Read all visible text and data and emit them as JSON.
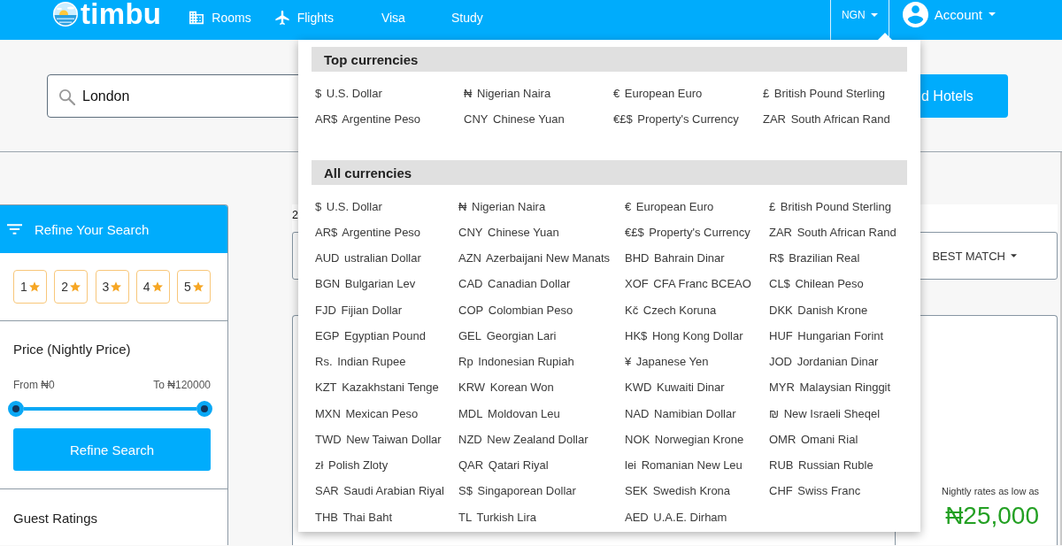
{
  "nav": {
    "logo": "timbu",
    "links": [
      {
        "label": "Rooms"
      },
      {
        "label": "Flights"
      },
      {
        "label": "Visa"
      },
      {
        "label": "Study"
      }
    ],
    "currency": "NGN",
    "account": "Account"
  },
  "search": {
    "value": "London",
    "button": "d Hotels"
  },
  "sidebar": {
    "title": "Refine Your Search",
    "star_filters": [
      "1",
      "2",
      "3",
      "4",
      "5"
    ],
    "price": {
      "title": "Price (Nightly Price)",
      "from": "From ₦0",
      "to": "To ₦120000",
      "thumbs": [
        {
          "level": 0
        },
        {
          "level": 1
        }
      ],
      "button": "Refine Search"
    },
    "guest_ratings": "Guest Ratings"
  },
  "results": {
    "heading": "2",
    "sort": "BEST MATCH",
    "card": {
      "rate_label": "Nightly rates as low as",
      "rate": "₦25,000"
    }
  },
  "currency_menu": {
    "expanded": true,
    "sections": [
      {
        "title": "Top currencies",
        "items": [
          {
            "symbol": "$",
            "name": "U.S. Dollar"
          },
          {
            "symbol": "₦",
            "name": "Nigerian Naira"
          },
          {
            "symbol": "€",
            "name": "European Euro"
          },
          {
            "symbol": "£",
            "name": "British Pound Sterling"
          },
          {
            "symbol": "AR$",
            "name": "Argentine Peso"
          },
          {
            "symbol": "CNY",
            "name": "Chinese Yuan"
          },
          {
            "symbol": "€£$",
            "name": "Property's Currency"
          },
          {
            "symbol": "ZAR",
            "name": "South African Rand"
          }
        ]
      },
      {
        "title": "All currencies",
        "items": [
          {
            "symbol": "$",
            "name": "U.S. Dollar"
          },
          {
            "symbol": "₦",
            "name": "Nigerian Naira"
          },
          {
            "symbol": "€",
            "name": "European Euro"
          },
          {
            "symbol": "£",
            "name": "British Pound Sterling"
          },
          {
            "symbol": "AR$",
            "name": "Argentine Peso"
          },
          {
            "symbol": "CNY",
            "name": "Chinese Yuan"
          },
          {
            "symbol": "€£$",
            "name": "Property's Currency"
          },
          {
            "symbol": "ZAR",
            "name": "South African Rand"
          },
          {
            "symbol": "AUD",
            "name": "ustralian Dollar"
          },
          {
            "symbol": "AZN",
            "name": "Azerbaijani New Manats"
          },
          {
            "symbol": "BHD",
            "name": "Bahrain Dinar"
          },
          {
            "symbol": "R$",
            "name": "Brazilian Real"
          },
          {
            "symbol": "BGN",
            "name": "Bulgarian Lev"
          },
          {
            "symbol": "CAD",
            "name": "Canadian Dollar"
          },
          {
            "symbol": "XOF",
            "name": "CFA Franc BCEAO"
          },
          {
            "symbol": "CL$",
            "name": "Chilean Peso"
          },
          {
            "symbol": "FJD",
            "name": "Fijian Dollar"
          },
          {
            "symbol": "COP",
            "name": "Colombian Peso"
          },
          {
            "symbol": "Kč",
            "name": "Czech Koruna"
          },
          {
            "symbol": "DKK",
            "name": "Danish Krone"
          },
          {
            "symbol": "EGP",
            "name": "Egyptian Pound"
          },
          {
            "symbol": "GEL",
            "name": "Georgian Lari"
          },
          {
            "symbol": "HK$",
            "name": "Hong Kong Dollar"
          },
          {
            "symbol": "HUF",
            "name": "Hungarian Forint"
          },
          {
            "symbol": "Rs.",
            "name": "Indian Rupee"
          },
          {
            "symbol": "Rp",
            "name": "Indonesian Rupiah"
          },
          {
            "symbol": "¥",
            "name": "Japanese Yen"
          },
          {
            "symbol": "JOD",
            "name": "Jordanian Dinar"
          },
          {
            "symbol": "KZT",
            "name": "Kazakhstani Tenge"
          },
          {
            "symbol": "KRW",
            "name": "Korean Won"
          },
          {
            "symbol": "KWD",
            "name": "Kuwaiti Dinar"
          },
          {
            "symbol": "MYR",
            "name": "Malaysian Ringgit"
          },
          {
            "symbol": "MXN",
            "name": "Mexican Peso"
          },
          {
            "symbol": "MDL",
            "name": "Moldovan Leu"
          },
          {
            "symbol": "NAD",
            "name": "Namibian Dollar"
          },
          {
            "symbol": "₪",
            "name": "New Israeli Sheqel"
          },
          {
            "symbol": "TWD",
            "name": "New Taiwan Dollar"
          },
          {
            "symbol": "NZD",
            "name": "New Zealand Dollar"
          },
          {
            "symbol": "NOK",
            "name": "Norwegian Krone"
          },
          {
            "symbol": "OMR",
            "name": "Omani Rial"
          },
          {
            "symbol": "zł",
            "name": "Polish Zloty"
          },
          {
            "symbol": "QAR",
            "name": "Qatari Riyal"
          },
          {
            "symbol": "lei",
            "name": "Romanian New Leu"
          },
          {
            "symbol": "RUB",
            "name": "Russian Ruble"
          },
          {
            "symbol": "SAR",
            "name": "Saudi Arabian Riyal"
          },
          {
            "symbol": "S$",
            "name": "Singaporean Dollar"
          },
          {
            "symbol": "SEK",
            "name": "Swedish Krona"
          },
          {
            "symbol": "CHF",
            "name": "Swiss Franc"
          },
          {
            "symbol": "THB",
            "name": "Thai Baht"
          },
          {
            "symbol": "TL",
            "name": "Turkish Lira"
          },
          {
            "symbol": "AED",
            "name": "U.A.E. Dirham"
          }
        ]
      }
    ]
  }
}
